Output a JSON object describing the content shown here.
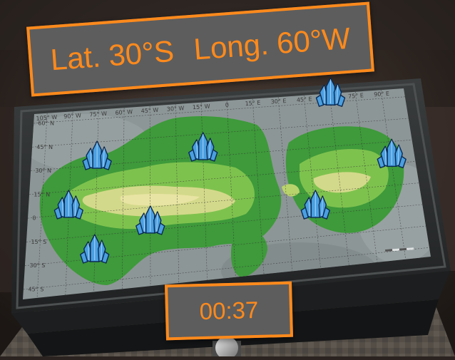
{
  "hud": {
    "latitude": "Lat. 30°S",
    "longitude": "Long. 60°W",
    "timer": "00:37"
  },
  "map": {
    "top_ticks": [
      "105° W",
      "90° W",
      "75° W",
      "60° W",
      "45° W",
      "30° W",
      "15° W",
      "0",
      "15° E",
      "30° E",
      "45° E",
      "60° E",
      "75° E",
      "90° E"
    ],
    "side_ticks": [
      "60° N",
      "45° N",
      "30° N",
      "15° N",
      "0",
      "15° S",
      "30° S",
      "45° S"
    ],
    "crystals": [
      {
        "id": "crystal-1",
        "lat": "30° N",
        "lon": "75° W"
      },
      {
        "id": "crystal-2",
        "lat": "30° N",
        "lon": "15° W"
      },
      {
        "id": "crystal-3",
        "lat": "60° N",
        "lon": "60° E"
      },
      {
        "id": "crystal-4",
        "lat": "15° N",
        "lon": "90° E"
      },
      {
        "id": "crystal-5",
        "lat": "0",
        "lon": "90° W"
      },
      {
        "id": "crystal-6",
        "lat": "15° S",
        "lon": "45° W"
      },
      {
        "id": "crystal-7",
        "lat": "15° S",
        "lon": "45° E"
      },
      {
        "id": "crystal-8",
        "lat": "30° S",
        "lon": "75° W"
      }
    ]
  },
  "colors": {
    "accent": "#ff8a1c",
    "panel": "#5d5d5d",
    "crystal": "#4a9fe0"
  }
}
